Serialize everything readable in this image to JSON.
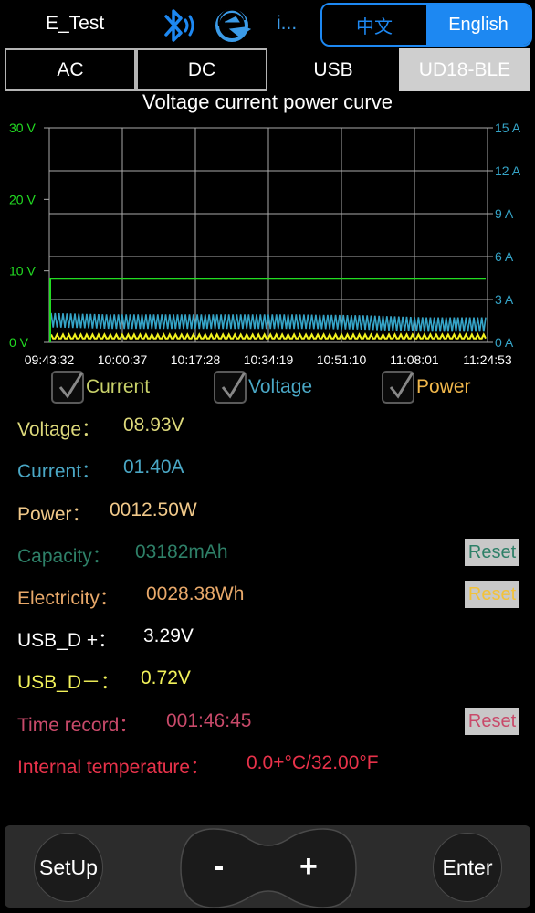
{
  "header": {
    "app_title": "E_Test",
    "info_label": "i...",
    "languages": [
      {
        "label": "中文",
        "selected": false
      },
      {
        "label": "English",
        "selected": true
      }
    ]
  },
  "tabs": [
    {
      "label": "AC"
    },
    {
      "label": "DC"
    },
    {
      "label": "USB"
    },
    {
      "label": "UD18-BLE",
      "selected": true
    }
  ],
  "chart_title": "Voltage current power curve",
  "chart_data": {
    "type": "line",
    "title": "Voltage current power curve",
    "x_ticks": [
      "09:43:32",
      "10:00:37",
      "10:17:28",
      "10:34:19",
      "10:51:10",
      "11:08:01",
      "11:24:53"
    ],
    "y_left_ticks": [
      "30 V",
      "20 V",
      "10 V",
      "0 V"
    ],
    "y_left_range": [
      0,
      30
    ],
    "y_right_ticks": [
      "15 A",
      "12 A",
      "9 A",
      "6 A",
      "3 A",
      "0 A"
    ],
    "y_right_range": [
      0,
      15
    ],
    "grid": true,
    "series": [
      {
        "name": "Voltage",
        "unit": "V",
        "axis": "left",
        "color": "#22dd22",
        "values": [
          0,
          8.9,
          8.9,
          8.9,
          8.9,
          8.9,
          8.9,
          8.9
        ]
      },
      {
        "name": "Current",
        "unit": "A",
        "axis": "right",
        "color": "#35a4c7",
        "values": [
          1.6,
          1.5,
          1.5,
          1.5,
          1.5,
          1.45,
          1.3,
          1.3
        ]
      },
      {
        "name": "Power",
        "unit": "W",
        "axis": "left",
        "color": "#f2f21e",
        "values": [
          0.5,
          0.4,
          0.4,
          0.4,
          0.4,
          0.4,
          0.4,
          0.4
        ]
      }
    ]
  },
  "legend": [
    {
      "label": "Current",
      "checked": true,
      "color": "#c9d26a"
    },
    {
      "label": "Voltage",
      "checked": true,
      "color": "#4aa7c5"
    },
    {
      "label": "Power",
      "checked": true,
      "color": "#f2b84b"
    }
  ],
  "readings": {
    "voltage": {
      "label": "Voltage：",
      "value": "08.93V",
      "label_color": "#ddd97b",
      "value_color": "#ddd97b"
    },
    "current": {
      "label": "Current：",
      "value": "01.40A",
      "label_color": "#4aa7c5",
      "value_color": "#4aa7c5"
    },
    "power": {
      "label": "Power：",
      "value": "0012.50W",
      "label_color": "#f1c98a",
      "value_color": "#f1c98a"
    },
    "capacity": {
      "label": "Capacity：",
      "value": "03182mAh",
      "label_color": "#2e8068",
      "value_color": "#2e8068",
      "reset": "Reset",
      "reset_color": "#2e8068"
    },
    "electricity": {
      "label": "Electricity：",
      "value": "0028.38Wh",
      "label_color": "#e9a96a",
      "value_color": "#e9a96a",
      "reset": "Reset",
      "reset_color": "#f2c23a"
    },
    "usb_d_plus": {
      "label": "USB_D +：",
      "value": "3.29V",
      "label_color": "#ffffff",
      "value_color": "#ffffff"
    },
    "usb_d_minus": {
      "label": "USB_D－：",
      "value": "0.72V",
      "label_color": "#f2f25a",
      "value_color": "#f2f25a"
    },
    "time_record": {
      "label": "Time record：",
      "value": "001:46:45",
      "label_color": "#c94a6a",
      "value_color": "#c94a6a",
      "reset": "Reset",
      "reset_color": "#c94a6a"
    },
    "temperature": {
      "label": "Internal temperature：",
      "value": "0.0+°C/32.00°F",
      "label_color": "#e8324a",
      "value_color": "#e8324a"
    }
  },
  "controls": {
    "setup": "SetUp",
    "minus": "-",
    "plus": "+",
    "enter": "Enter"
  }
}
